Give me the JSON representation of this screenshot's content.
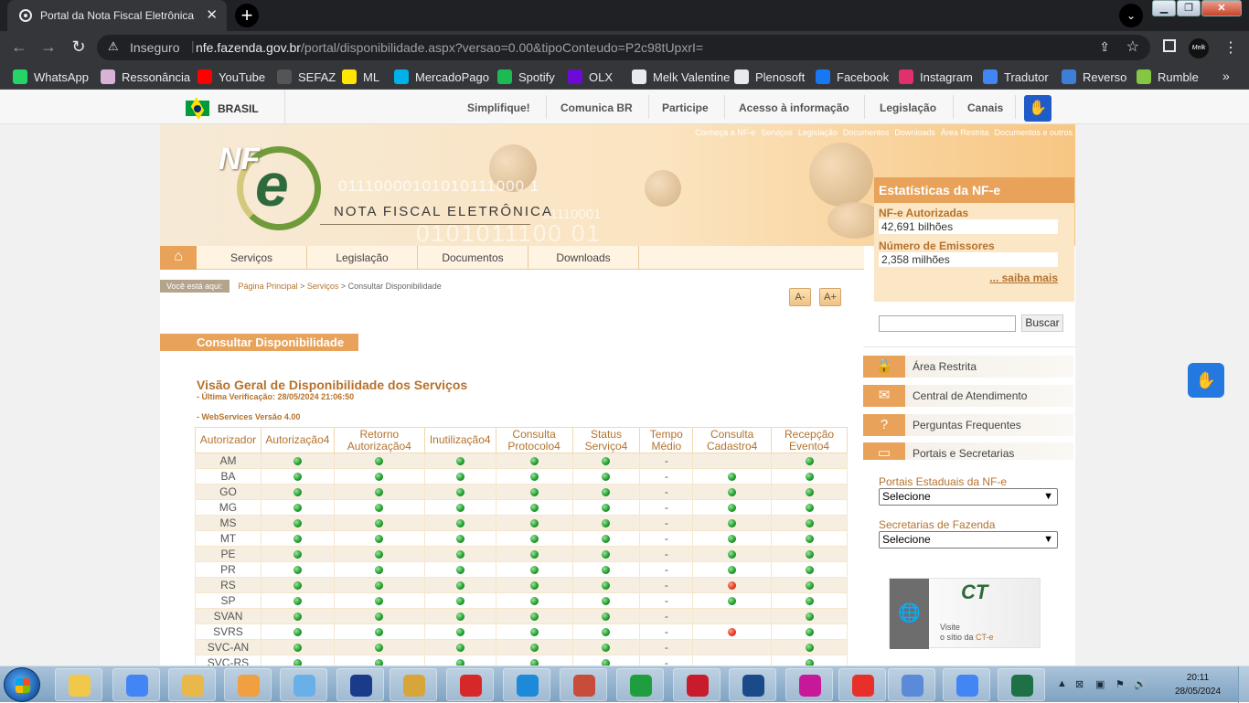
{
  "browser": {
    "tab_title": "Portal da Nota Fiscal Eletrônica",
    "insecure_label": "Inseguro",
    "url_host": "nfe.fazenda.gov.br",
    "url_path": "/portal/disponibilidade.aspx?versao=0.00&tipoConteudo=P2c98tUpxrI=",
    "profile_label": "Melk",
    "bookmarks": [
      {
        "label": "WhatsApp",
        "color": "#25d366"
      },
      {
        "label": "Ressonância",
        "color": "#d9b3d6"
      },
      {
        "label": "YouTube",
        "color": "#ff0000"
      },
      {
        "label": "SEFAZ",
        "color": "#555555"
      },
      {
        "label": "ML",
        "color": "#ffe600"
      },
      {
        "label": "MercadoPago",
        "color": "#00b1ea"
      },
      {
        "label": "Spotify",
        "color": "#1db954"
      },
      {
        "label": "OLX",
        "color": "#6e0ad6"
      },
      {
        "label": "Melk Valentine",
        "color": "#e8eaed"
      },
      {
        "label": "Plenosoft",
        "color": "#e8eaed"
      },
      {
        "label": "Facebook",
        "color": "#1877f2"
      },
      {
        "label": "Instagram",
        "color": "#e1306c"
      },
      {
        "label": "Tradutor",
        "color": "#4285f4"
      },
      {
        "label": "Reverso",
        "color": "#3d7fd6"
      },
      {
        "label": "Rumble",
        "color": "#85c742"
      }
    ]
  },
  "govbar": {
    "country": "BRASIL",
    "links": [
      "Simplifique!",
      "Comunica BR",
      "Participe",
      "Acesso à informação",
      "Legislação",
      "Canais"
    ]
  },
  "banner": {
    "logo_text": "NF",
    "logo_e": "e",
    "title": "NOTA FISCAL ELETRÔNICA",
    "binary_1": "01110000101010111000 1",
    "binary_2": "0101011100 01",
    "binary_3": "01110001",
    "top_links": [
      "Conheça a NF-e",
      "Serviços",
      "Legislação",
      "Documentos",
      "Downloads",
      "Área Restrita",
      "Documentos e outros"
    ]
  },
  "nav": {
    "items": [
      "Serviços",
      "Legislação",
      "Documentos",
      "Downloads"
    ]
  },
  "breadcrumb": {
    "here_label": "Você está aqui:",
    "home": "Página Principal",
    "services": "Serviços",
    "current": "Consultar Disponibilidade"
  },
  "font_controls": {
    "decrease": "A-",
    "increase": "A+"
  },
  "content": {
    "section_title": "Consultar Disponibilidade",
    "heading": "Visão Geral de Disponibilidade dos Serviços",
    "last_check": "- Última Verificação: 28/05/2024 21:06:50",
    "ws_version": "- WebServices Versão 4.00"
  },
  "availability": {
    "columns": [
      "Autorizador",
      "Autorização4",
      "Retorno Autorização4",
      "Inutilização4",
      "Consulta Protocolo4",
      "Status Serviço4",
      "Tempo Médio",
      "Consulta Cadastro4",
      "Recepção Evento4"
    ],
    "rows": [
      {
        "autorizador": "AM",
        "cells": [
          "green",
          "green",
          "green",
          "green",
          "green",
          "-",
          "",
          "green"
        ]
      },
      {
        "autorizador": "BA",
        "cells": [
          "green",
          "green",
          "green",
          "green",
          "green",
          "-",
          "green",
          "green"
        ]
      },
      {
        "autorizador": "GO",
        "cells": [
          "green",
          "green",
          "green",
          "green",
          "green",
          "-",
          "green",
          "green"
        ]
      },
      {
        "autorizador": "MG",
        "cells": [
          "green",
          "green",
          "green",
          "green",
          "green",
          "-",
          "green",
          "green"
        ]
      },
      {
        "autorizador": "MS",
        "cells": [
          "green",
          "green",
          "green",
          "green",
          "green",
          "-",
          "green",
          "green"
        ]
      },
      {
        "autorizador": "MT",
        "cells": [
          "green",
          "green",
          "green",
          "green",
          "green",
          "-",
          "green",
          "green"
        ]
      },
      {
        "autorizador": "PE",
        "cells": [
          "green",
          "green",
          "green",
          "green",
          "green",
          "-",
          "green",
          "green"
        ]
      },
      {
        "autorizador": "PR",
        "cells": [
          "green",
          "green",
          "green",
          "green",
          "green",
          "-",
          "green",
          "green"
        ]
      },
      {
        "autorizador": "RS",
        "cells": [
          "green",
          "green",
          "green",
          "green",
          "green",
          "-",
          "red",
          "green"
        ]
      },
      {
        "autorizador": "SP",
        "cells": [
          "green",
          "green",
          "green",
          "green",
          "green",
          "-",
          "green",
          "green"
        ]
      },
      {
        "autorizador": "SVAN",
        "cells": [
          "green",
          "green",
          "green",
          "green",
          "green",
          "-",
          "",
          "green"
        ]
      },
      {
        "autorizador": "SVRS",
        "cells": [
          "green",
          "green",
          "green",
          "green",
          "green",
          "-",
          "red",
          "green"
        ]
      },
      {
        "autorizador": "SVC-AN",
        "cells": [
          "green",
          "green",
          "green",
          "green",
          "green",
          "-",
          "",
          "green"
        ]
      },
      {
        "autorizador": "SVC-RS",
        "cells": [
          "green",
          "green",
          "green",
          "green",
          "green",
          "-",
          "",
          "green"
        ]
      }
    ]
  },
  "stats": {
    "title": "Estatísticas da NF-e",
    "authorized_label": "NF-e Autorizadas",
    "authorized_value": "42,691 bilhões",
    "emitters_label": "Número de Emissores",
    "emitters_value": "2,358 milhões",
    "more": "... saiba mais"
  },
  "search": {
    "button": "Buscar",
    "value": ""
  },
  "right_links": [
    "Área Restrita",
    "Central de Atendimento",
    "Perguntas Frequentes",
    "Portais e Secretarias"
  ],
  "selects": {
    "portais_label": "Portais Estaduais da NF-e",
    "portais_value": "Selecione",
    "secretarias_label": "Secretarias de Fazenda",
    "secretarias_value": "Selecione"
  },
  "cte": {
    "logo": "CT",
    "line1": "Visite",
    "line2": "o sítio da",
    "link": "CT-e"
  },
  "taskbar": {
    "apps": [
      {
        "name": "explorer",
        "color": "#f2c84b"
      },
      {
        "name": "chrome",
        "color": "#4285f4"
      },
      {
        "name": "app-yellow",
        "color": "#e8b84a"
      },
      {
        "name": "paint",
        "color": "#f0a040"
      },
      {
        "name": "notepad",
        "color": "#6ab0e8"
      },
      {
        "name": "app-blue",
        "color": "#1a3a8a"
      },
      {
        "name": "app-7",
        "color": "#d7a63a"
      },
      {
        "name": "rx",
        "color": "#d62828"
      },
      {
        "name": "app-p1",
        "color": "#1c8ad8"
      },
      {
        "name": "app-p2",
        "color": "#c84c3a"
      },
      {
        "name": "app-p3",
        "color": "#1e9e3e"
      },
      {
        "name": "app-p4",
        "color": "#c81c2c"
      },
      {
        "name": "app-p5",
        "color": "#1a4a8a"
      },
      {
        "name": "app-p6",
        "color": "#c8189a"
      },
      {
        "name": "anydesk",
        "color": "#e8302a"
      },
      {
        "name": "paint2",
        "color": "#5a8ad8"
      },
      {
        "name": "chrome-melk",
        "color": "#4285f4"
      },
      {
        "name": "excel",
        "color": "#1e7145"
      }
    ],
    "time": "20:11",
    "date": "28/05/2024"
  }
}
